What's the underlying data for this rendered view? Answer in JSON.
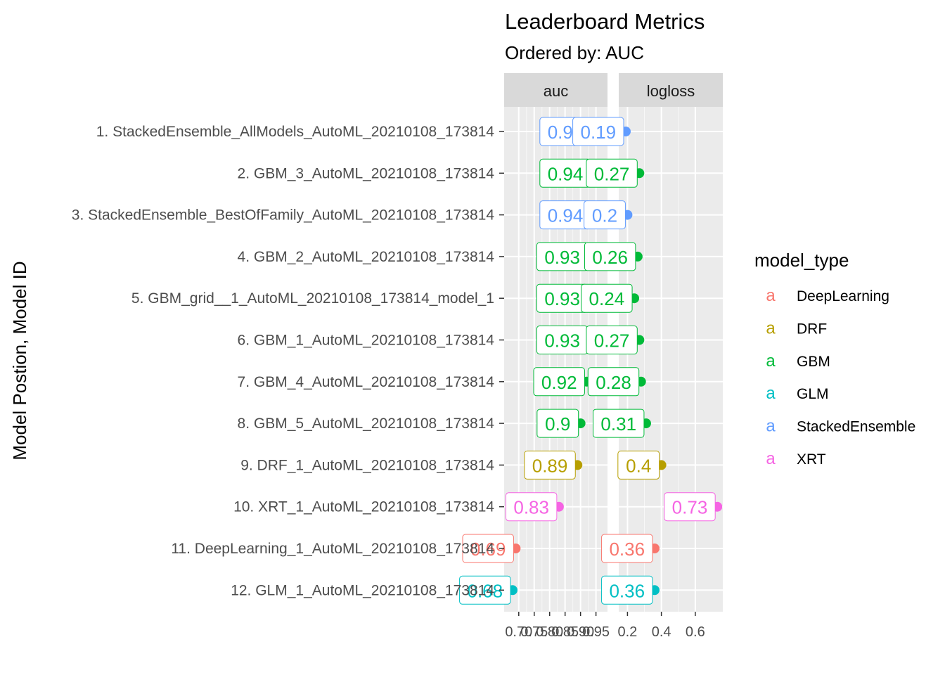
{
  "chart_data": {
    "type": "scatter",
    "title": "Leaderboard Metrics",
    "subtitle": "Ordered by: AUC",
    "ylabel": "Model Postion, Model ID",
    "xlabel": "",
    "facets": [
      "auc",
      "logloss"
    ],
    "axes": {
      "auc": {
        "xlim": [
          0.68,
          0.96
        ],
        "ticks": [
          0.7,
          0.75,
          0.8,
          0.85,
          0.9,
          0.95
        ],
        "tick_labels": [
          "0.70",
          "0.75",
          "0.80",
          "0.85",
          "0.90",
          "0.95"
        ]
      },
      "logloss": {
        "xlim": [
          0.19,
          0.75
        ],
        "ticks": [
          0.2,
          0.4,
          0.6
        ],
        "tick_labels": [
          "0.2",
          "0.4",
          "0.6"
        ]
      }
    },
    "grid": true,
    "legend": {
      "title": "model_type",
      "placement": "right",
      "key_glyph": "a",
      "entries": [
        {
          "name": "DeepLearning",
          "color": "#F8766D"
        },
        {
          "name": "DRF",
          "color": "#B79F00"
        },
        {
          "name": "GBM",
          "color": "#00BA38"
        },
        {
          "name": "GLM",
          "color": "#00BFC4"
        },
        {
          "name": "StackedEnsemble",
          "color": "#619CFF"
        },
        {
          "name": "XRT",
          "color": "#F564E3"
        }
      ]
    },
    "models": [
      {
        "id": "1. StackedEnsemble_AllModels_AutoML_20210108_173814",
        "type": "StackedEnsemble",
        "auc": 0.94,
        "logloss": 0.19,
        "auc_label": "0.94",
        "logloss_label": "0.19"
      },
      {
        "id": "2. GBM_3_AutoML_20210108_173814",
        "type": "GBM",
        "auc": 0.94,
        "logloss": 0.27,
        "auc_label": "0.94",
        "logloss_label": "0.27"
      },
      {
        "id": "3. StackedEnsemble_BestOfFamily_AutoML_20210108_173814",
        "type": "StackedEnsemble",
        "auc": 0.94,
        "logloss": 0.2,
        "auc_label": "0.94",
        "logloss_label": "0.2"
      },
      {
        "id": "4. GBM_2_AutoML_20210108_173814",
        "type": "GBM",
        "auc": 0.93,
        "logloss": 0.26,
        "auc_label": "0.93",
        "logloss_label": "0.26"
      },
      {
        "id": "5. GBM_grid__1_AutoML_20210108_173814_model_1",
        "type": "GBM",
        "auc": 0.93,
        "logloss": 0.24,
        "auc_label": "0.93",
        "logloss_label": "0.24"
      },
      {
        "id": "6. GBM_1_AutoML_20210108_173814",
        "type": "GBM",
        "auc": 0.93,
        "logloss": 0.27,
        "auc_label": "0.93",
        "logloss_label": "0.27"
      },
      {
        "id": "7. GBM_4_AutoML_20210108_173814",
        "type": "GBM",
        "auc": 0.92,
        "logloss": 0.28,
        "auc_label": "0.92",
        "logloss_label": "0.28"
      },
      {
        "id": "8. GBM_5_AutoML_20210108_173814",
        "type": "GBM",
        "auc": 0.9,
        "logloss": 0.31,
        "auc_label": "0.9",
        "logloss_label": "0.31"
      },
      {
        "id": "9. DRF_1_AutoML_20210108_173814",
        "type": "DRF",
        "auc": 0.89,
        "logloss": 0.4,
        "auc_label": "0.89",
        "logloss_label": "0.4"
      },
      {
        "id": "10. XRT_1_AutoML_20210108_173814",
        "type": "XRT",
        "auc": 0.83,
        "logloss": 0.73,
        "auc_label": "0.83",
        "logloss_label": "0.73"
      },
      {
        "id": "11. DeepLearning_1_AutoML_20210108_173814",
        "type": "DeepLearning",
        "auc": 0.69,
        "logloss": 0.36,
        "auc_label": "0.69",
        "logloss_label": "0.36"
      },
      {
        "id": "12. GLM_1_AutoML_20210108_173814",
        "type": "GLM",
        "auc": 0.68,
        "logloss": 0.36,
        "auc_label": "0.68",
        "logloss_label": "0.36"
      }
    ]
  }
}
